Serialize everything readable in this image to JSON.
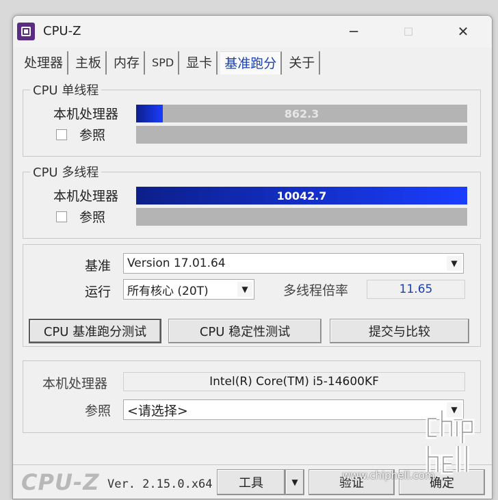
{
  "window": {
    "title": "CPU-Z",
    "min_glyph": "─",
    "max_glyph": "☐",
    "close_glyph": "✕"
  },
  "tabs": [
    {
      "label": "处理器"
    },
    {
      "label": "主板"
    },
    {
      "label": "内存"
    },
    {
      "label": "SPD"
    },
    {
      "label": "显卡"
    },
    {
      "label": "基准跑分",
      "active": true
    },
    {
      "label": "关于"
    }
  ],
  "single_thread": {
    "title": "CPU 单线程",
    "this_cpu_label": "本机处理器",
    "this_cpu_score": "862.3",
    "this_cpu_fill_fraction": 0.08,
    "reference_label": "参照"
  },
  "multi_thread": {
    "title": "CPU 多线程",
    "this_cpu_label": "本机处理器",
    "this_cpu_score": "10042.7",
    "this_cpu_fill_fraction": 1.0,
    "reference_label": "参照"
  },
  "settings": {
    "benchmark_label": "基准",
    "benchmark_value": "Version 17.01.64",
    "run_label": "运行",
    "run_value": "所有核心 (20T)",
    "ratio_label": "多线程倍率",
    "ratio_value": "11.65",
    "bench_button": "CPU 基准跑分测试",
    "stress_button": "CPU 稳定性测试",
    "submit_button": "提交与比较"
  },
  "cpu_info": {
    "this_cpu_label": "本机处理器",
    "this_cpu_value": "Intel(R) Core(TM) i5-14600KF",
    "reference_label": "参照",
    "reference_value": "<请选择>"
  },
  "footer": {
    "logo": "CPU-Z",
    "version": "Ver. 2.15.0.x64",
    "tools_button": "工具",
    "validate_button": "验证",
    "ok_button": "确定"
  },
  "watermark": {
    "url": "www.chiphell.com",
    "text": "chip hell"
  },
  "colors": {
    "accent_blue": "#1a3dff",
    "dark_blue": "#0c1f8a",
    "ratio_text": "#1a3fb0"
  }
}
